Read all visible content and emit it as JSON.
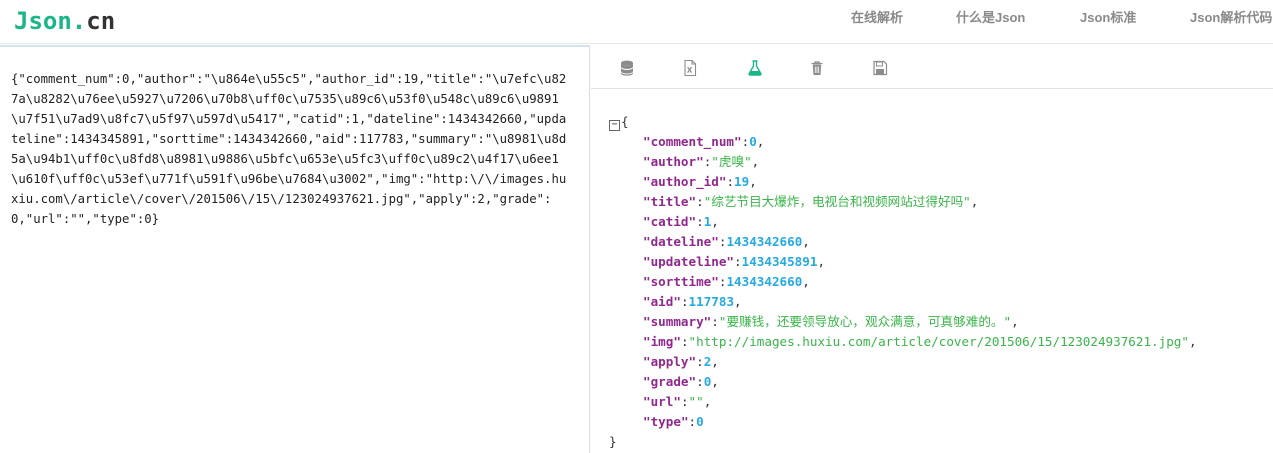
{
  "logo": {
    "part1": "Json",
    "dot": ".",
    "part2": "cn"
  },
  "nav": [
    {
      "label": "在线解析"
    },
    {
      "label": "什么是Json"
    },
    {
      "label": "Json标准"
    },
    {
      "label": "Json解析代码"
    }
  ],
  "editor": {
    "raw": "{\"comment_num\":0,\"author\":\"\\u864e\\u55c5\",\"author_id\":19,\"title\":\"\\u7efc\\u827a\\u8282\\u76ee\\u5927\\u7206\\u70b8\\uff0c\\u7535\\u89c6\\u53f0\\u548c\\u89c6\\u9891\\u7f51\\u7ad9\\u8fc7\\u5f97\\u597d\\u5417\",\"catid\":1,\"dateline\":1434342660,\"updateline\":1434345891,\"sorttime\":1434342660,\"aid\":117783,\"summary\":\"\\u8981\\u8d5a\\u94b1\\uff0c\\u8fd8\\u8981\\u9886\\u5bfc\\u653e\\u5fc3\\uff0c\\u89c2\\u4f17\\u6ee1\\u610f\\uff0c\\u53ef\\u771f\\u591f\\u96be\\u7684\\u3002\",\"img\":\"http:\\/\\/images.huxiu.com\\/article\\/cover\\/201506\\/15\\/123024937621.jpg\",\"apply\":2,\"grade\":0,\"url\":\"\",\"type\":0}"
  },
  "toolbar": {
    "icons": [
      "database-icon",
      "excel-file-icon",
      "flask-icon",
      "trash-icon",
      "save-icon"
    ],
    "accent": "#1ab68a"
  },
  "tree": {
    "open_brace": "{",
    "close_brace": "}",
    "collapse_symbol": "−",
    "entries": [
      {
        "key": "comment_num",
        "value": "0",
        "type": "number"
      },
      {
        "key": "author",
        "value": "虎嗅",
        "type": "string"
      },
      {
        "key": "author_id",
        "value": "19",
        "type": "number"
      },
      {
        "key": "title",
        "value": "综艺节目大爆炸，电视台和视频网站过得好吗",
        "type": "string"
      },
      {
        "key": "catid",
        "value": "1",
        "type": "number"
      },
      {
        "key": "dateline",
        "value": "1434342660",
        "type": "number"
      },
      {
        "key": "updateline",
        "value": "1434345891",
        "type": "number"
      },
      {
        "key": "sorttime",
        "value": "1434342660",
        "type": "number"
      },
      {
        "key": "aid",
        "value": "117783",
        "type": "number"
      },
      {
        "key": "summary",
        "value": "要赚钱，还要领导放心，观众满意，可真够难的。",
        "type": "string"
      },
      {
        "key": "img",
        "value": "http://images.huxiu.com/article/cover/201506/15/123024937621.jpg",
        "type": "string"
      },
      {
        "key": "apply",
        "value": "2",
        "type": "number"
      },
      {
        "key": "grade",
        "value": "0",
        "type": "number"
      },
      {
        "key": "url",
        "value": "",
        "type": "string"
      },
      {
        "key": "type",
        "value": "0",
        "type": "number"
      }
    ]
  },
  "colors": {
    "key": "#92278f",
    "number": "#25aae2",
    "string": "#3ab54a",
    "nav_text": "#8a8a8a",
    "brand_green": "#1ab68a"
  }
}
